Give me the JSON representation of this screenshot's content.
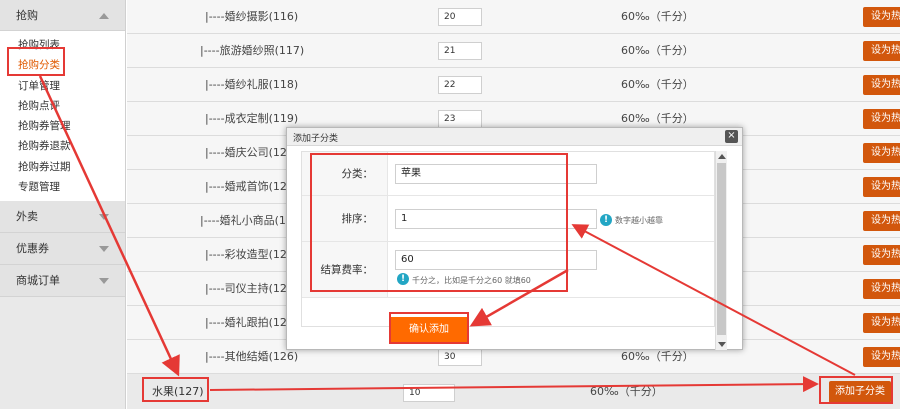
{
  "sidebar": {
    "groups": [
      {
        "label": "抢购"
      },
      {
        "label": "外卖"
      },
      {
        "label": "优惠券"
      },
      {
        "label": "商城订单"
      }
    ],
    "sub_items": [
      {
        "label": "抢购列表"
      },
      {
        "label": "抢购分类"
      },
      {
        "label": "订单管理"
      },
      {
        "label": "抢购点评"
      },
      {
        "label": "抢购券管理"
      },
      {
        "label": "抢购券退款"
      },
      {
        "label": "抢购券过期"
      },
      {
        "label": "专题管理"
      }
    ],
    "active_sub_item": "抢购分类"
  },
  "table": {
    "rows": [
      {
        "name": "|----婚纱摄影(116)",
        "sort": "20",
        "rate": "60‰（千分）",
        "action": "设为热"
      },
      {
        "name": "|----旅游婚纱照(117)",
        "sort": "21",
        "rate": "60‰（千分）",
        "action": "设为热"
      },
      {
        "name": "|----婚纱礼服(118)",
        "sort": "22",
        "rate": "60‰（千分）",
        "action": "设为热"
      },
      {
        "name": "|----成衣定制(119)",
        "sort": "23",
        "rate": "60‰（千分）",
        "action": "设为热"
      },
      {
        "name": "|----婚庆公司(120)",
        "sort": "",
        "rate": "",
        "action": "设为热"
      },
      {
        "name": "|----婚戒首饰(121)",
        "sort": "",
        "rate": "",
        "action": "设为热"
      },
      {
        "name": "|----婚礼小商品(122)",
        "sort": "",
        "rate": "",
        "action": "设为热"
      },
      {
        "name": "|----彩妆造型(123)",
        "sort": "",
        "rate": "",
        "action": "设为热"
      },
      {
        "name": "|----司仪主持(124)",
        "sort": "",
        "rate": "",
        "action": "设为热"
      },
      {
        "name": "|----婚礼跟拍(125)",
        "sort": "",
        "rate": "",
        "action": "设为热"
      },
      {
        "name": "|----其他结婚(126)",
        "sort": "30",
        "rate": "60‰（千分）",
        "action": "设为热"
      }
    ],
    "last_row": {
      "name": "水果(127)",
      "sort": "10",
      "rate": "60‰（千分）",
      "action": "添加子分类"
    }
  },
  "modal": {
    "title": "添加子分类",
    "close": "×",
    "fields": {
      "category": {
        "label": "分类：",
        "value": "苹果"
      },
      "sort": {
        "label": "排序：",
        "value": "1",
        "hint": "数字越小越靠"
      },
      "rate": {
        "label": "结算费率：",
        "value": "60",
        "hint": "千分之，比如是千分之60 就填60"
      }
    },
    "hint_icon": "!",
    "confirm_label": "确认添加"
  },
  "colors": {
    "accent_orange": "#d2570c",
    "confirm_orange": "#ff6a00",
    "annotation_red": "#e53935",
    "hint_blue": "#22a6c4"
  }
}
